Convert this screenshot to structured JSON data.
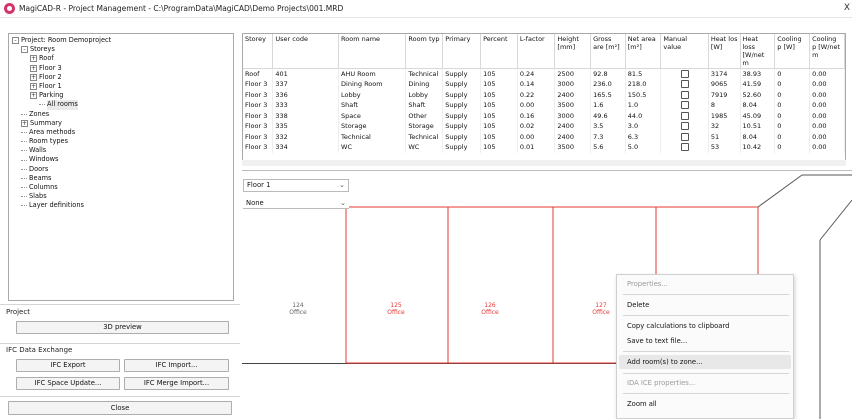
{
  "window": {
    "title": "MagiCAD-R - Project Management - C:\\ProgramData\\MagiCAD\\Demo Projects\\001.MRD",
    "close_glyph": "X"
  },
  "tree": [
    {
      "label": "Project: Room Demoproject",
      "indent": 0,
      "exp": "-"
    },
    {
      "label": "Storeys",
      "indent": 1,
      "exp": "-"
    },
    {
      "label": "Roof",
      "indent": 2,
      "exp": "+"
    },
    {
      "label": "Floor 3",
      "indent": 2,
      "exp": "+"
    },
    {
      "label": "Floor 2",
      "indent": 2,
      "exp": "+"
    },
    {
      "label": "Floor 1",
      "indent": 2,
      "exp": "+"
    },
    {
      "label": "Parking",
      "indent": 2,
      "exp": "+"
    },
    {
      "label": "All rooms",
      "indent": 3,
      "exp": "",
      "selected": true
    },
    {
      "label": "Zones",
      "indent": 1,
      "exp": ""
    },
    {
      "label": "Summary",
      "indent": 1,
      "exp": "+"
    },
    {
      "label": "Area methods",
      "indent": 1,
      "exp": ""
    },
    {
      "label": "Room types",
      "indent": 1,
      "exp": ""
    },
    {
      "label": "Walls",
      "indent": 1,
      "exp": ""
    },
    {
      "label": "Windows",
      "indent": 1,
      "exp": ""
    },
    {
      "label": "Doors",
      "indent": 1,
      "exp": ""
    },
    {
      "label": "Beams",
      "indent": 1,
      "exp": ""
    },
    {
      "label": "Columns",
      "indent": 1,
      "exp": ""
    },
    {
      "label": "Slabs",
      "indent": 1,
      "exp": ""
    },
    {
      "label": "Layer definitions",
      "indent": 1,
      "exp": ""
    }
  ],
  "project_section": {
    "label": "Project",
    "preview_button": "3D preview"
  },
  "ifc_section": {
    "label": "IFC Data Exchange",
    "export_button": "IFC Export",
    "import_button": "IFC Import...",
    "space_update_button": "IFC Space Update...",
    "merge_import_button": "IFC Merge Import...",
    "close_button": "Close"
  },
  "table": {
    "headers": [
      "Storey",
      "User code",
      "Room name",
      "Room typ",
      "Primary",
      "Percent",
      "L-factor",
      "Height [mm]",
      "Gross are [m²]",
      "Net area [m²]",
      "Manual value",
      "Heat los [W]",
      "Heat loss [W/net m",
      "Cooling p [W]",
      "Cooling p [W/net m"
    ],
    "rows": [
      [
        "Roof",
        "401",
        "AHU Room",
        "Technical",
        "Supply",
        "105",
        "0.24",
        "2500",
        "92.8",
        "81.5",
        "",
        "3174",
        "38.93",
        "0",
        "0.00"
      ],
      [
        "Floor 3",
        "337",
        "Dining Room",
        "Dining",
        "Supply",
        "105",
        "0.14",
        "3000",
        "236.0",
        "218.0",
        "",
        "9065",
        "41.59",
        "0",
        "0.00"
      ],
      [
        "Floor 3",
        "336",
        "Lobby",
        "Lobby",
        "Supply",
        "105",
        "0.22",
        "2400",
        "165.5",
        "150.5",
        "",
        "7919",
        "52.60",
        "0",
        "0.00"
      ],
      [
        "Floor 3",
        "333",
        "Shaft",
        "Shaft",
        "Supply",
        "105",
        "0.00",
        "3500",
        "1.6",
        "1.0",
        "",
        "8",
        "8.04",
        "0",
        "0.00"
      ],
      [
        "Floor 3",
        "338",
        "Space",
        "Other",
        "Supply",
        "105",
        "0.16",
        "3000",
        "49.6",
        "44.0",
        "",
        "1985",
        "45.09",
        "0",
        "0.00"
      ],
      [
        "Floor 3",
        "335",
        "Storage",
        "Storage",
        "Supply",
        "105",
        "0.02",
        "2400",
        "3.5",
        "3.0",
        "",
        "32",
        "10.51",
        "0",
        "0.00"
      ],
      [
        "Floor 3",
        "332",
        "Technical",
        "Technical",
        "Supply",
        "105",
        "0.00",
        "2400",
        "7.3",
        "6.3",
        "",
        "51",
        "8.04",
        "0",
        "0.00"
      ],
      [
        "Floor 3",
        "334",
        "WC",
        "WC",
        "Supply",
        "105",
        "0.01",
        "3500",
        "5.6",
        "5.0",
        "",
        "53",
        "10.42",
        "0",
        "0.00"
      ]
    ]
  },
  "floorplan": {
    "floor_value": "Floor 1",
    "layer_value": "None",
    "rooms": [
      {
        "number": "124",
        "type": "Office",
        "highlighted": false
      },
      {
        "number": "125",
        "type": "Office",
        "highlighted": true
      },
      {
        "number": "126",
        "type": "Office",
        "highlighted": true
      },
      {
        "number": "127",
        "type": "Office",
        "highlighted": true
      }
    ],
    "highlight_color": "#e53935"
  },
  "context_menu": {
    "items": [
      {
        "label": "Properties...",
        "disabled": true
      },
      {
        "label": "Delete",
        "disabled": false
      },
      {
        "label": "Copy calculations to clipboard",
        "disabled": false
      },
      {
        "label": "Save to text file...",
        "disabled": false
      },
      {
        "label": "Add room(s) to zone...",
        "disabled": false,
        "hovered": true
      },
      {
        "label": "IDA ICE properties...",
        "disabled": true
      },
      {
        "label": "Zoom all",
        "disabled": false
      }
    ]
  }
}
